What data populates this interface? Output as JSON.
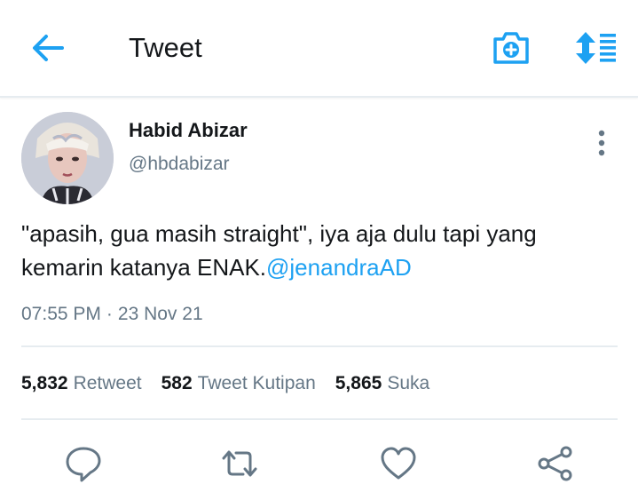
{
  "header": {
    "title": "Tweet",
    "back_icon": "arrow-left-icon",
    "camera_icon": "camera-plus-icon",
    "sort_icon": "sort-updown-list-icon",
    "accent_color": "#1da1f2"
  },
  "tweet": {
    "author": {
      "display_name": "Habid Abizar",
      "handle": "@hbdabizar"
    },
    "text": "\"apasih, gua masih straight\", iya aja dulu tapi yang kemarin katanya ENAK.",
    "mention": "@jenandraAD",
    "time": "07:55 PM",
    "separator": "·",
    "date": "23 Nov 21",
    "stats": {
      "retweets": "5,832",
      "retweets_label": "Retweet",
      "quotes": "582",
      "quotes_label": "Tweet Kutipan",
      "likes": "5,865",
      "likes_label": "Suka"
    }
  },
  "actions": {
    "reply_icon": "reply-bubble-icon",
    "retweet_icon": "retweet-icon",
    "like_icon": "heart-icon",
    "share_icon": "share-icon"
  },
  "colors": {
    "text": "#14171a",
    "secondary": "#657786",
    "link": "#1da1f2",
    "divider": "#e6ecf0"
  }
}
